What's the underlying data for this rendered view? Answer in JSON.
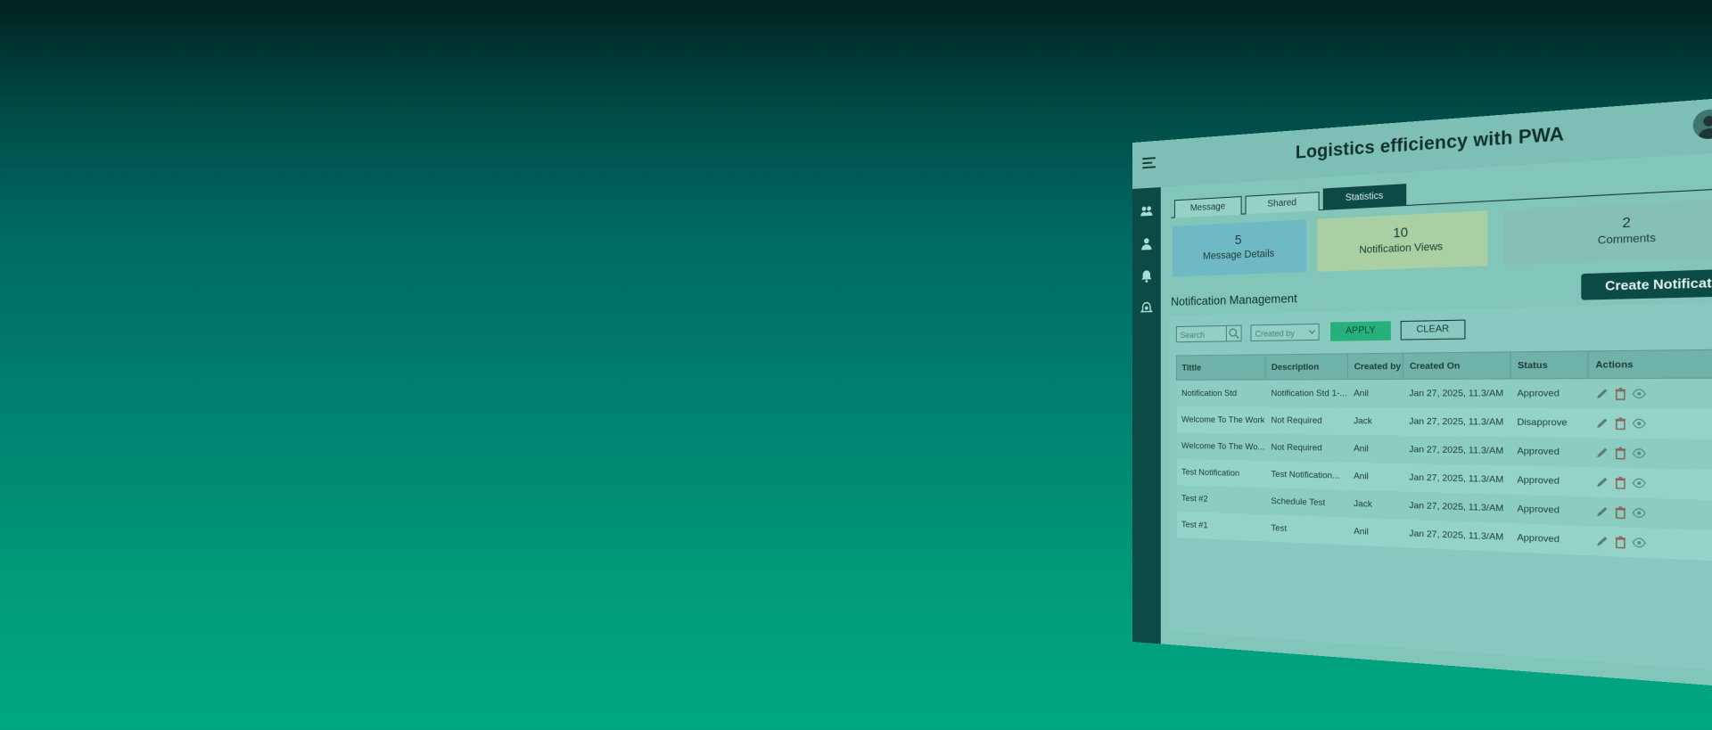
{
  "app": {
    "title": "Logistics efficiency with PWA"
  },
  "header": {
    "menu_icon": "hamburger-icon",
    "avatar_icon": "user-avatar",
    "dropdown_icon": "chevron-down-icon"
  },
  "sidebar": {
    "items": [
      {
        "icon": "users-group-icon"
      },
      {
        "icon": "user-icon"
      },
      {
        "icon": "notification-bell-icon"
      },
      {
        "icon": "settings-bell-icon"
      }
    ]
  },
  "tabs": [
    {
      "label": "Message",
      "active": false
    },
    {
      "label": "Shared",
      "active": false
    },
    {
      "label": "Statistics",
      "active": true
    }
  ],
  "stats": [
    {
      "value": "5",
      "label": "Message Details",
      "color": "#6fb9c4"
    },
    {
      "value": "10",
      "label": "Notification Views",
      "color": "#a9cfa2"
    },
    {
      "value": "2",
      "label": "Comments",
      "color": "#86bfb6"
    }
  ],
  "section": {
    "title": "Notification Management"
  },
  "create_button": {
    "label": "Create Notification"
  },
  "filters": {
    "search_placeholder": "Search",
    "created_by_placeholder": "Created by",
    "apply_label": "APPLY",
    "clear_label": "CLEAR"
  },
  "table": {
    "columns": [
      "Tittle",
      "Description",
      "Created by",
      "Created On",
      "Status",
      "Actions"
    ],
    "rows": [
      {
        "title": "Notification Std",
        "description": "Notification Std 1-...",
        "created_by": "Anil",
        "created_on": "Jan 27, 2025, 11.3/AM",
        "status": "Approved"
      },
      {
        "title": "Welcome To The  Work",
        "description": "Not Required",
        "created_by": "Jack",
        "created_on": "Jan 27, 2025, 11.3/AM",
        "status": "Disapprove"
      },
      {
        "title": "Welcome To The  Wo...",
        "description": "Not Required",
        "created_by": "Anil",
        "created_on": "Jan 27, 2025, 11.3/AM",
        "status": "Approved"
      },
      {
        "title": "Test Notification",
        "description": "Test Notification...",
        "created_by": "Anil",
        "created_on": "Jan 27, 2025, 11.3/AM",
        "status": "Approved"
      },
      {
        "title": "Test #2",
        "description": "Schedule Test",
        "created_by": "Jack",
        "created_on": "Jan 27, 2025, 11.3/AM",
        "status": "Approved"
      },
      {
        "title": "Test #1",
        "description": "Test",
        "created_by": "Anil",
        "created_on": "Jan 27, 2025, 11.3/AM",
        "status": "Approved"
      }
    ],
    "action_icons": [
      "edit-icon",
      "delete-icon",
      "view-icon"
    ]
  }
}
